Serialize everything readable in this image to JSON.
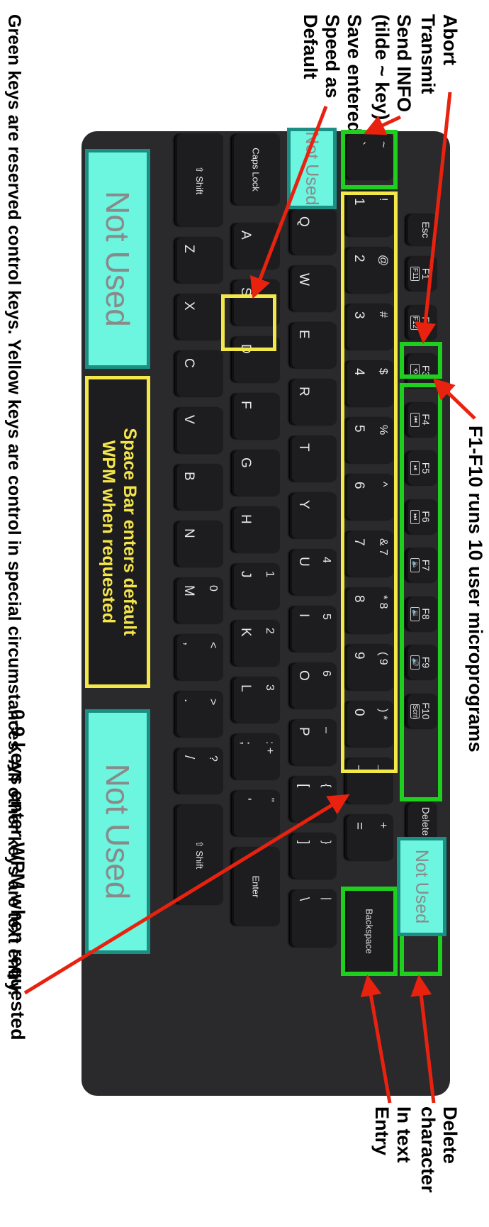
{
  "annotations": {
    "f_keys": "F1-F10 runs 10 user microprograms",
    "digits": "0-9 keys enter WPM when requested",
    "abort": [
      "Abort",
      "Transmit"
    ],
    "send_info": [
      "Send INFO",
      "(tilde ~ key)"
    ],
    "save_speed": [
      "Save entered",
      "Speed as",
      "Default"
    ],
    "delete": [
      "Delete",
      "character"
    ],
    "backspace": [
      "In text",
      "Entry"
    ],
    "footer": "Green keys are reserved control keys. Yellow keys are control in special circumstances. All other keys are text entry."
  },
  "overlays": {
    "not_used": "Not Used",
    "space_bar": [
      "Space Bar enters default",
      "WPM when requested"
    ]
  },
  "colors": {
    "green": "#1ecf1e",
    "yellow": "#f2e84a",
    "cyan": "#6cf5df",
    "arrow": "#e8220f",
    "keyboard": "#2a2a2c"
  },
  "keyboard": {
    "row_fn": [
      {
        "label": "Esc",
        "sub": ""
      },
      {
        "label": "F1",
        "sub": "F11"
      },
      {
        "label": "F2",
        "sub": "F12"
      },
      {
        "label": "F3",
        "sub": "⟲"
      },
      {
        "label": "F4",
        "sub": "⏮"
      },
      {
        "label": "F5",
        "sub": "⏯"
      },
      {
        "label": "F6",
        "sub": "⏭"
      },
      {
        "label": "F7",
        "sub": "🔈"
      },
      {
        "label": "F8",
        "sub": "🔉"
      },
      {
        "label": "F9",
        "sub": "🔊"
      },
      {
        "label": "F10",
        "sub": "Scrn"
      },
      {
        "label": "Delete",
        "sub": ""
      }
    ],
    "row_num": [
      {
        "top": "~",
        "main": "`"
      },
      {
        "top": "!",
        "main": "1"
      },
      {
        "top": "@",
        "main": "2"
      },
      {
        "top": "#",
        "main": "3"
      },
      {
        "top": "$",
        "main": "4"
      },
      {
        "top": "%",
        "main": "5"
      },
      {
        "top": "^",
        "main": "6"
      },
      {
        "top": "& 7",
        "main": "7"
      },
      {
        "top": "* 8",
        "main": "8"
      },
      {
        "top": "( 9",
        "main": "9"
      },
      {
        "top": ") *",
        "main": "0"
      },
      {
        "top": "_",
        "main": "–"
      },
      {
        "top": "+",
        "main": "="
      },
      {
        "top": "",
        "main": "Backspace"
      }
    ],
    "row_q": [
      {
        "top": "",
        "main": "Q"
      },
      {
        "top": "",
        "main": "W"
      },
      {
        "top": "",
        "main": "E"
      },
      {
        "top": "",
        "main": "R"
      },
      {
        "top": "",
        "main": "T"
      },
      {
        "top": "",
        "main": "Y"
      },
      {
        "top": "4",
        "main": "U"
      },
      {
        "top": "5",
        "main": "I"
      },
      {
        "top": "6",
        "main": "O"
      },
      {
        "top": "–",
        "main": "P"
      },
      {
        "top": "{",
        "main": "["
      },
      {
        "top": "}",
        "main": "]"
      },
      {
        "top": "|",
        "main": "\\"
      }
    ],
    "row_a": [
      {
        "top": "",
        "main": "Caps Lock"
      },
      {
        "top": "",
        "main": "A"
      },
      {
        "top": "",
        "main": "S"
      },
      {
        "top": "",
        "main": "D"
      },
      {
        "top": "",
        "main": "F"
      },
      {
        "top": "",
        "main": "G"
      },
      {
        "top": "",
        "main": "H"
      },
      {
        "top": "1",
        "main": "J"
      },
      {
        "top": "2",
        "main": "K"
      },
      {
        "top": "3",
        "main": "L"
      },
      {
        "top": ": +",
        "main": ";"
      },
      {
        "top": "\"",
        "main": "'"
      },
      {
        "top": "",
        "main": "Enter"
      }
    ],
    "row_z": [
      {
        "top": "",
        "main": "⇧ Shift"
      },
      {
        "top": "",
        "main": "Z"
      },
      {
        "top": "",
        "main": "X"
      },
      {
        "top": "",
        "main": "C"
      },
      {
        "top": "",
        "main": "V"
      },
      {
        "top": "",
        "main": "B"
      },
      {
        "top": "",
        "main": "N"
      },
      {
        "top": "0",
        "main": "M"
      },
      {
        "top": "<",
        "main": ","
      },
      {
        "top": ">",
        "main": "."
      },
      {
        "top": "?",
        "main": "/"
      },
      {
        "top": "",
        "main": "⇧ Shift"
      }
    ]
  }
}
